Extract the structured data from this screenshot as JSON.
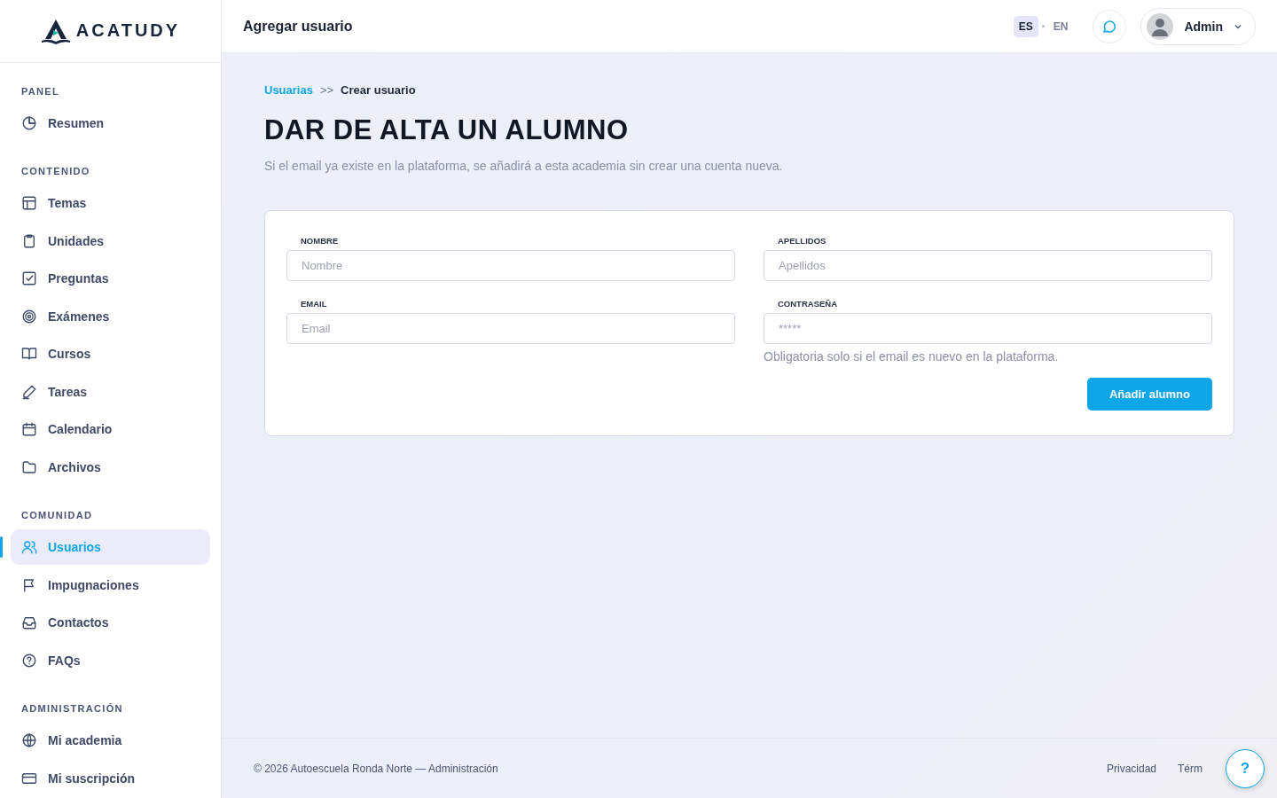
{
  "logo": {
    "name": "ACATUDY"
  },
  "sidebar": {
    "sections": [
      {
        "title": "PANEL",
        "items": [
          {
            "label": "Resumen",
            "selected": false
          }
        ]
      },
      {
        "title": "CONTENIDO",
        "items": [
          {
            "label": "Temas",
            "selected": false
          },
          {
            "label": "Unidades",
            "selected": false
          },
          {
            "label": "Preguntas",
            "selected": false
          },
          {
            "label": "Exámenes",
            "selected": false
          },
          {
            "label": "Cursos",
            "selected": false
          },
          {
            "label": "Tareas",
            "selected": false
          },
          {
            "label": "Calendario",
            "selected": false
          },
          {
            "label": "Archivos",
            "selected": false
          }
        ]
      },
      {
        "title": "COMUNIDAD",
        "items": [
          {
            "label": "Usuarios",
            "selected": true
          },
          {
            "label": "Impugnaciones",
            "selected": false
          },
          {
            "label": "Contactos",
            "selected": false
          },
          {
            "label": "FAQs",
            "selected": false
          }
        ]
      },
      {
        "title": "ADMINISTRACIÓN",
        "items": [
          {
            "label": "Mi academia",
            "selected": false
          },
          {
            "label": "Mi suscripción",
            "selected": false
          }
        ]
      }
    ]
  },
  "header": {
    "title": "Agregar usuario",
    "languages": [
      {
        "label": "ES",
        "selected": true
      },
      {
        "label": "EN",
        "selected": false
      }
    ],
    "user": "Admin"
  },
  "breadcrumb": {
    "parent": "Usuarias",
    "separator": ">>",
    "current": "Crear usuario"
  },
  "page_title": "DAR DE ALTA UN ALUMNO",
  "description": "Si el email ya existe en la plataforma, se añadirá a esta academia sin crear una cuenta nueva.",
  "form": {
    "fields": [
      {
        "label": "NOMBRE",
        "placeholder": "Nombre"
      },
      {
        "label": "APELLIDOS",
        "placeholder": "Apellidos"
      },
      {
        "label": "EMAIL",
        "placeholder": "Email"
      },
      {
        "label": "CONTRASEÑA",
        "placeholder": "*****",
        "hint": "Obligatoria solo si el email es nuevo en la plataforma."
      }
    ],
    "submit": "Añadir alumno"
  },
  "footer": {
    "copyright": "© 2026 Autoescuela Ronda Norte — Administración",
    "links": [
      "Privacidad",
      "Térm"
    ]
  },
  "help_button": "?"
}
